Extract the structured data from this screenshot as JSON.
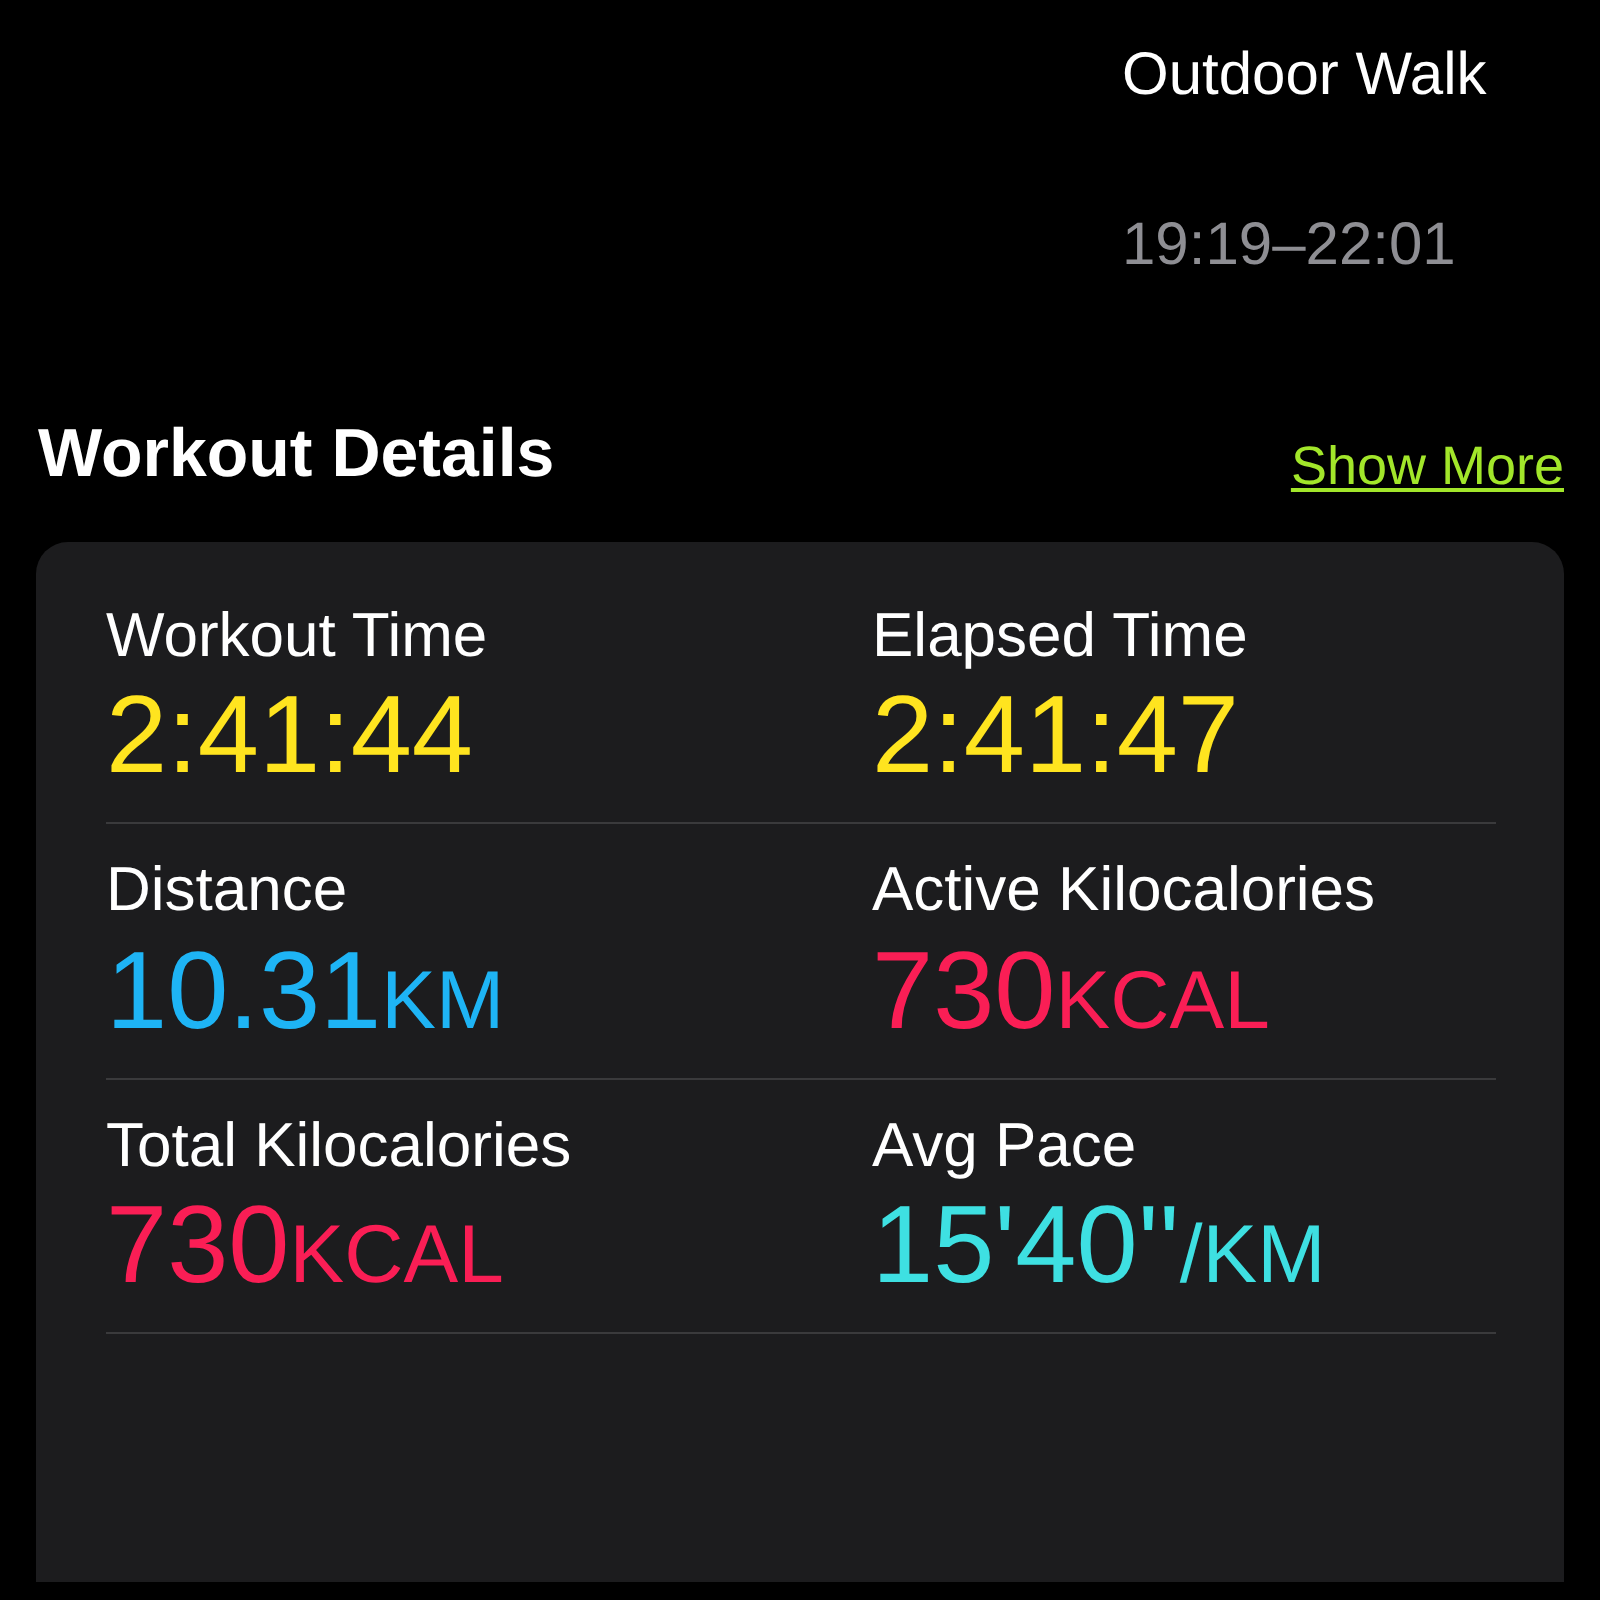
{
  "header": {
    "title": "Outdoor Walk",
    "time_range": "19:19–22:01"
  },
  "section": {
    "title": "Workout Details",
    "link": "Show More"
  },
  "metrics": [
    {
      "label": "Workout Time",
      "value": "2:41:44",
      "color": "#ffe41f"
    },
    {
      "label": "Elapsed Time",
      "value": "2:41:47",
      "color": "#ffe41f"
    },
    {
      "label": "Distance",
      "value": "10.31",
      "unit": "KM",
      "color": "#1eb4f5"
    },
    {
      "label": "Active Kilocalories",
      "value": "730",
      "unit": "KCAL",
      "color": "#fa1e55"
    },
    {
      "label": "Total Kilocalories",
      "value": "730",
      "unit": "KCAL",
      "color": "#fa1e55"
    },
    {
      "label": "Avg Pace",
      "value": "15'40''",
      "unit": "/KM",
      "color": "#3ee0e2"
    }
  ]
}
